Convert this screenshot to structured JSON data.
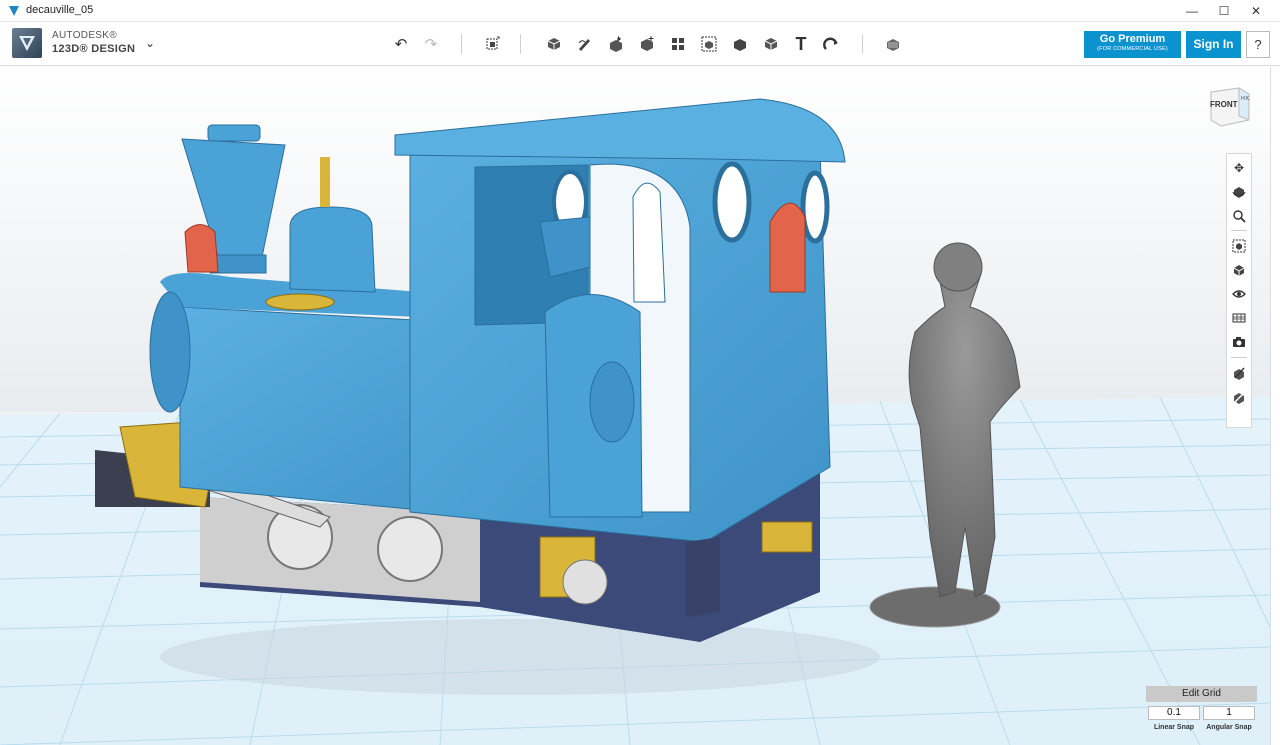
{
  "window": {
    "title": "decauville_05",
    "controls": [
      "—",
      "☐",
      "✕"
    ]
  },
  "brand": {
    "line1": "AUTODESK®",
    "line2": "123D® DESIGN"
  },
  "toolbar": {
    "undo_icon": "undo-icon",
    "redo_icon": "redo-icon",
    "tools": [
      "transform",
      "primitives",
      "sketch",
      "construct",
      "modify",
      "pattern",
      "group",
      "combine",
      "measure",
      "text",
      "snap",
      "material"
    ],
    "premium": {
      "label": "Go Premium",
      "sub": "(FOR COMMERCIAL USE)"
    },
    "signin": "Sign In",
    "help": "?"
  },
  "viewcube": {
    "face": "FRONT",
    "side": "RIGHT"
  },
  "nav_tools": [
    "pan-icon",
    "orbit-icon",
    "zoom-icon",
    "fit-icon",
    "views-icon",
    "visibility-icon",
    "materials-icon",
    "screenshot-icon",
    "snap-icon",
    "edit-icon"
  ],
  "grid_panel": {
    "title": "Edit Grid",
    "linear_value": "0.1",
    "angular_value": "1",
    "linear_label": "Linear Snap",
    "angular_label": "Angular Snap"
  },
  "colors": {
    "accent": "#0a93cf",
    "loco_blue": "#4aa2d6",
    "brass": "#d9b53a",
    "lamp": "#e2644a",
    "figure": "#7a7a7a",
    "grid_line": "#b9dcee"
  }
}
